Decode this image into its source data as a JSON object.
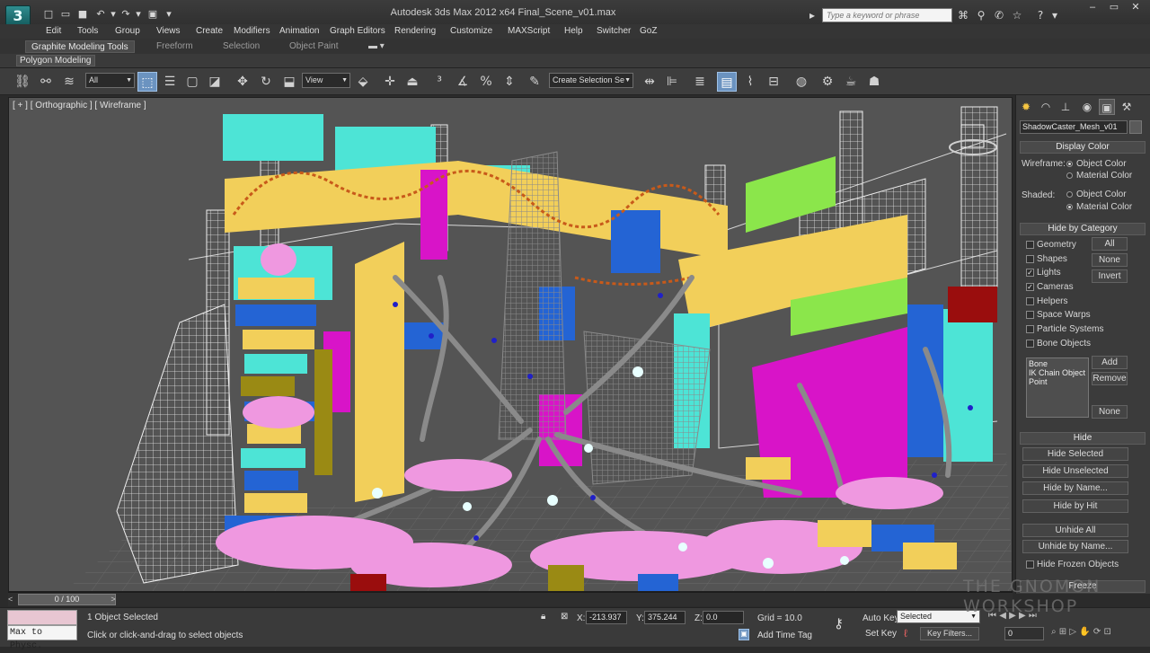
{
  "app": {
    "logo_glyph": "3",
    "title": "Autodesk 3ds Max  2012 x64      Final_Scene_v01.max",
    "search_placeholder": "Type a keyword or phrase"
  },
  "menu": [
    "Edit",
    "Tools",
    "Group",
    "Views",
    "Create",
    "Modifiers",
    "Animation",
    "Graph Editors",
    "Rendering",
    "Customize",
    "MAXScript",
    "Help",
    "Switcher",
    "GoZ"
  ],
  "ribbon": {
    "tabs": [
      "Graphite Modeling Tools",
      "Freeform",
      "Selection",
      "Object Paint"
    ],
    "active_tab": "Graphite Modeling Tools",
    "panel_tab": "Polygon Modeling"
  },
  "toolbar": {
    "filter_value": "All",
    "coord_system": "View",
    "selection_set_placeholder": "Create Selection Se"
  },
  "viewport": {
    "label": "[ + ] [ Orthographic ] [ Wireframe ]",
    "background": "#545454"
  },
  "command_panel": {
    "object_name": "ShadowCaster_Mesh_v01",
    "display_color": {
      "title": "Display Color",
      "wireframe_label": "Wireframe:",
      "shaded_label": "Shaded:",
      "object_color": "Object Color",
      "material_color": "Material Color"
    },
    "hide_by_category": {
      "title": "Hide by Category",
      "items": [
        {
          "label": "Geometry",
          "checked": false
        },
        {
          "label": "Shapes",
          "checked": false
        },
        {
          "label": "Lights",
          "checked": true
        },
        {
          "label": "Cameras",
          "checked": true
        },
        {
          "label": "Helpers",
          "checked": false
        },
        {
          "label": "Space Warps",
          "checked": false
        },
        {
          "label": "Particle Systems",
          "checked": false
        },
        {
          "label": "Bone Objects",
          "checked": false
        }
      ],
      "all_btn": "All",
      "none_btn": "None",
      "invert_btn": "Invert",
      "list": [
        "Bone",
        "IK Chain Object",
        "Point"
      ],
      "add_btn": "Add",
      "remove_btn": "Remove",
      "none2_btn": "None"
    },
    "hide": {
      "title": "Hide",
      "buttons": [
        "Hide Selected",
        "Hide Unselected",
        "Hide by Name...",
        "Hide by Hit",
        "Unhide All",
        "Unhide by Name..."
      ],
      "frozen_label": "Hide Frozen Objects"
    },
    "freeze_title": "Freeze"
  },
  "timeline": {
    "label": "0 / 100",
    "position": 0,
    "total": 100
  },
  "status": {
    "listener_text": "Max to Physc.",
    "selected": "1 Object Selected",
    "prompt": "Click or click-and-drag to select objects",
    "x_label": "X:",
    "x_value": "-213.937",
    "y_label": "Y:",
    "y_value": "375.244",
    "z_label": "Z:",
    "z_value": "0.0",
    "grid": "Grid = 10.0",
    "auto_key": "Auto Key",
    "set_key": "Set Key",
    "selected_dropdown": "Selected",
    "key_filters": "Key Filters...",
    "add_time_tag": "Add Time Tag",
    "frame": "0"
  },
  "watermark": "THE GNOMON WORKSHOP",
  "colors": {
    "cyan": "#4de4d6",
    "yellow": "#f2cf5a",
    "magenta": "#d814c8",
    "blue": "#2464d4",
    "pink": "#ef98e0",
    "green": "#8be64b",
    "olive": "#9a8a14",
    "red": "#9a0d0d",
    "gray_wire": "#8a8a8a",
    "accent": "#6b93c0"
  }
}
